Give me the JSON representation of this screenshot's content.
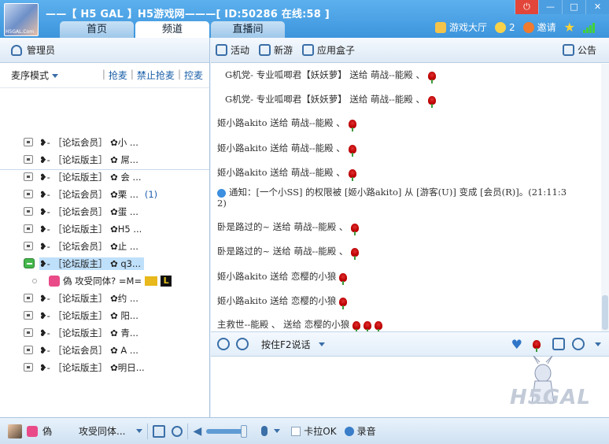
{
  "window": {
    "title": "——【 H5 GAL 】H5游戏网———[ ID:50286 在线:58 ]",
    "logo_label": "H5GAL.Com",
    "controls": [
      "⏻",
      "—",
      "□",
      "✕"
    ]
  },
  "tabs": [
    {
      "label": "首页",
      "active": false
    },
    {
      "label": "频道",
      "active": true
    },
    {
      "label": "直播间",
      "active": false
    }
  ],
  "topbar": {
    "game_hall": "游戏大厅",
    "coins": "2",
    "invite": "邀请"
  },
  "left_panel": {
    "admin_label": "管理员",
    "queue_mode": "麦序模式",
    "links": [
      "抢麦",
      "禁止抢麦",
      "控麦"
    ],
    "members": [
      {
        "text": "❥- ［论坛会员］ ✿小  ...",
        "extra": "",
        "type": "normal"
      },
      {
        "text": "❥- ［论坛版主］ ✿  屌...",
        "extra": "",
        "type": "normal"
      },
      {
        "text": "❥- ［论坛版主］ ✿ 会 ...",
        "extra": "",
        "type": "normal"
      },
      {
        "text": "❥- ［论坛会员］ ✿栗  ...",
        "extra": "(1)",
        "type": "normal"
      },
      {
        "text": "❥- ［论坛会员］ ✿蛋  ...",
        "extra": "",
        "type": "normal"
      },
      {
        "text": "❥- ［论坛版主］ ✿H5  ...",
        "extra": "",
        "type": "normal"
      },
      {
        "text": "❥- ［论坛会员］ ✿止  ...",
        "extra": "",
        "type": "normal"
      },
      {
        "text": "❥- ［论坛版主］ ✿   q3...",
        "extra": "",
        "type": "selected"
      },
      {
        "text": "偽    攻受同体?  =M=",
        "extra": "L",
        "type": "sub"
      },
      {
        "text": "❥- ［论坛版主］ ✿约  ...",
        "extra": "",
        "type": "normal"
      },
      {
        "text": "❥- ［论坛版主］ ✿ 阳...",
        "extra": "",
        "type": "normal"
      },
      {
        "text": "❥- ［论坛版主］ ✿  青...",
        "extra": "",
        "type": "normal"
      },
      {
        "text": "❥- ［论坛会员］ ✿ A  ...",
        "extra": "",
        "type": "normal"
      },
      {
        "text": "❥- ［论坛版主］ ✿明日...",
        "extra": "",
        "type": "normal"
      }
    ]
  },
  "toolbar": {
    "activity": "活动",
    "new_game": "新游",
    "app_box": "应用盒子",
    "notice": "公告"
  },
  "chat": [
    {
      "text": "G机党- 专业呱唧君【妖妖萝】 送给            萌战--能殿 、",
      "roses": 1,
      "kind": "gift"
    },
    {
      "text": "G机党- 专业呱唧君【妖妖萝】 送给            萌战--能殿 、",
      "roses": 1,
      "kind": "gift"
    },
    {
      "text": "姬小路akito 送给              萌战--能殿 、",
      "roses": 1,
      "kind": "gift"
    },
    {
      "text": "姬小路akito 送给              萌战--能殿 、",
      "roses": 1,
      "kind": "gift"
    },
    {
      "text": "姬小路akito 送给              萌战--能殿 、",
      "roses": 1,
      "kind": "gift"
    },
    {
      "text": "通知：[一个小SS] 的权限被 [姬小路akito] 从 [游客(U)] 变成 [会员(R)]。(21:11:3",
      "roses": 0,
      "kind": "info"
    },
    {
      "text": "2)",
      "roses": 0,
      "kind": "info-cont"
    },
    {
      "text": "卧是路过的~ 送给              萌战--能殿 、",
      "roses": 1,
      "kind": "gift"
    },
    {
      "text": "卧是路过的~ 送给              萌战--能殿 、",
      "roses": 1,
      "kind": "gift"
    },
    {
      "text": "姬小路akito 送给 恋樱的小狼",
      "roses": 1,
      "kind": "gift"
    },
    {
      "text": "姬小路akito 送给 恋樱的小狼",
      "roses": 1,
      "kind": "gift"
    },
    {
      "text": "      主救世--能殿 、 送给 恋樱的小狼",
      "roses": 3,
      "kind": "gift"
    }
  ],
  "input_bar": {
    "push_to_talk": "按住F2说话"
  },
  "bottom_bar": {
    "nickname": "偽",
    "status": "攻受同体...",
    "karaoke": "卡拉OK",
    "record": "录音"
  },
  "colors": {
    "title_bar": "#3d95dc",
    "rose": "#d01818",
    "info_text": "#1f3f9e",
    "selection": "#bfe0fb"
  }
}
